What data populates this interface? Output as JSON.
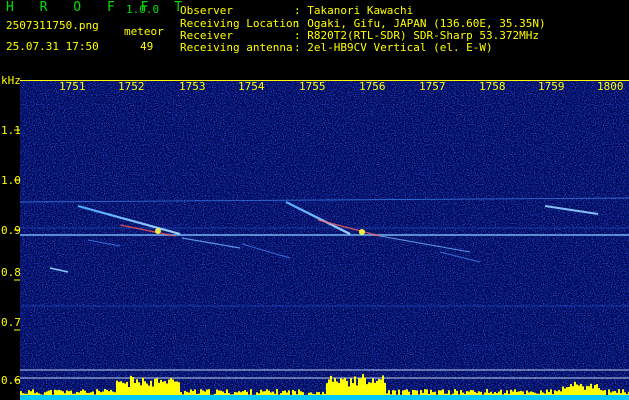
{
  "header": {
    "app_name": "H R O F F T",
    "version": "1.0.0",
    "filename": "2507311750.png",
    "datetime": "25.07.31 17:50",
    "meteor_label": "meteor",
    "meteor_count": "49",
    "info_labels": [
      "Observer",
      "Receiving Location",
      "Receiver",
      "Receiving antenna"
    ],
    "info_values": [
      ": Takanori Kawachi",
      ": Ogaki, Gifu, JAPAN (136.60E, 35.35N)",
      ": R820T2(RTL-SDR) SDR-Sharp 53.372MHz",
      ": 2el-HB9CV Vertical (el. E-W)"
    ]
  },
  "spectrogram": {
    "y_unit": "kHz",
    "x_ticks": [
      "1751",
      "1752",
      "1753",
      "1754",
      "1755",
      "1756",
      "1757",
      "1758",
      "1759",
      "1800"
    ],
    "y_ticks": [
      "1.1",
      "1.0",
      "0.9",
      "0.8",
      "0.7",
      "0.6"
    ]
  },
  "colors": {
    "header_text": "#ffff00",
    "label_text": "#00e000",
    "background": "#000000"
  }
}
